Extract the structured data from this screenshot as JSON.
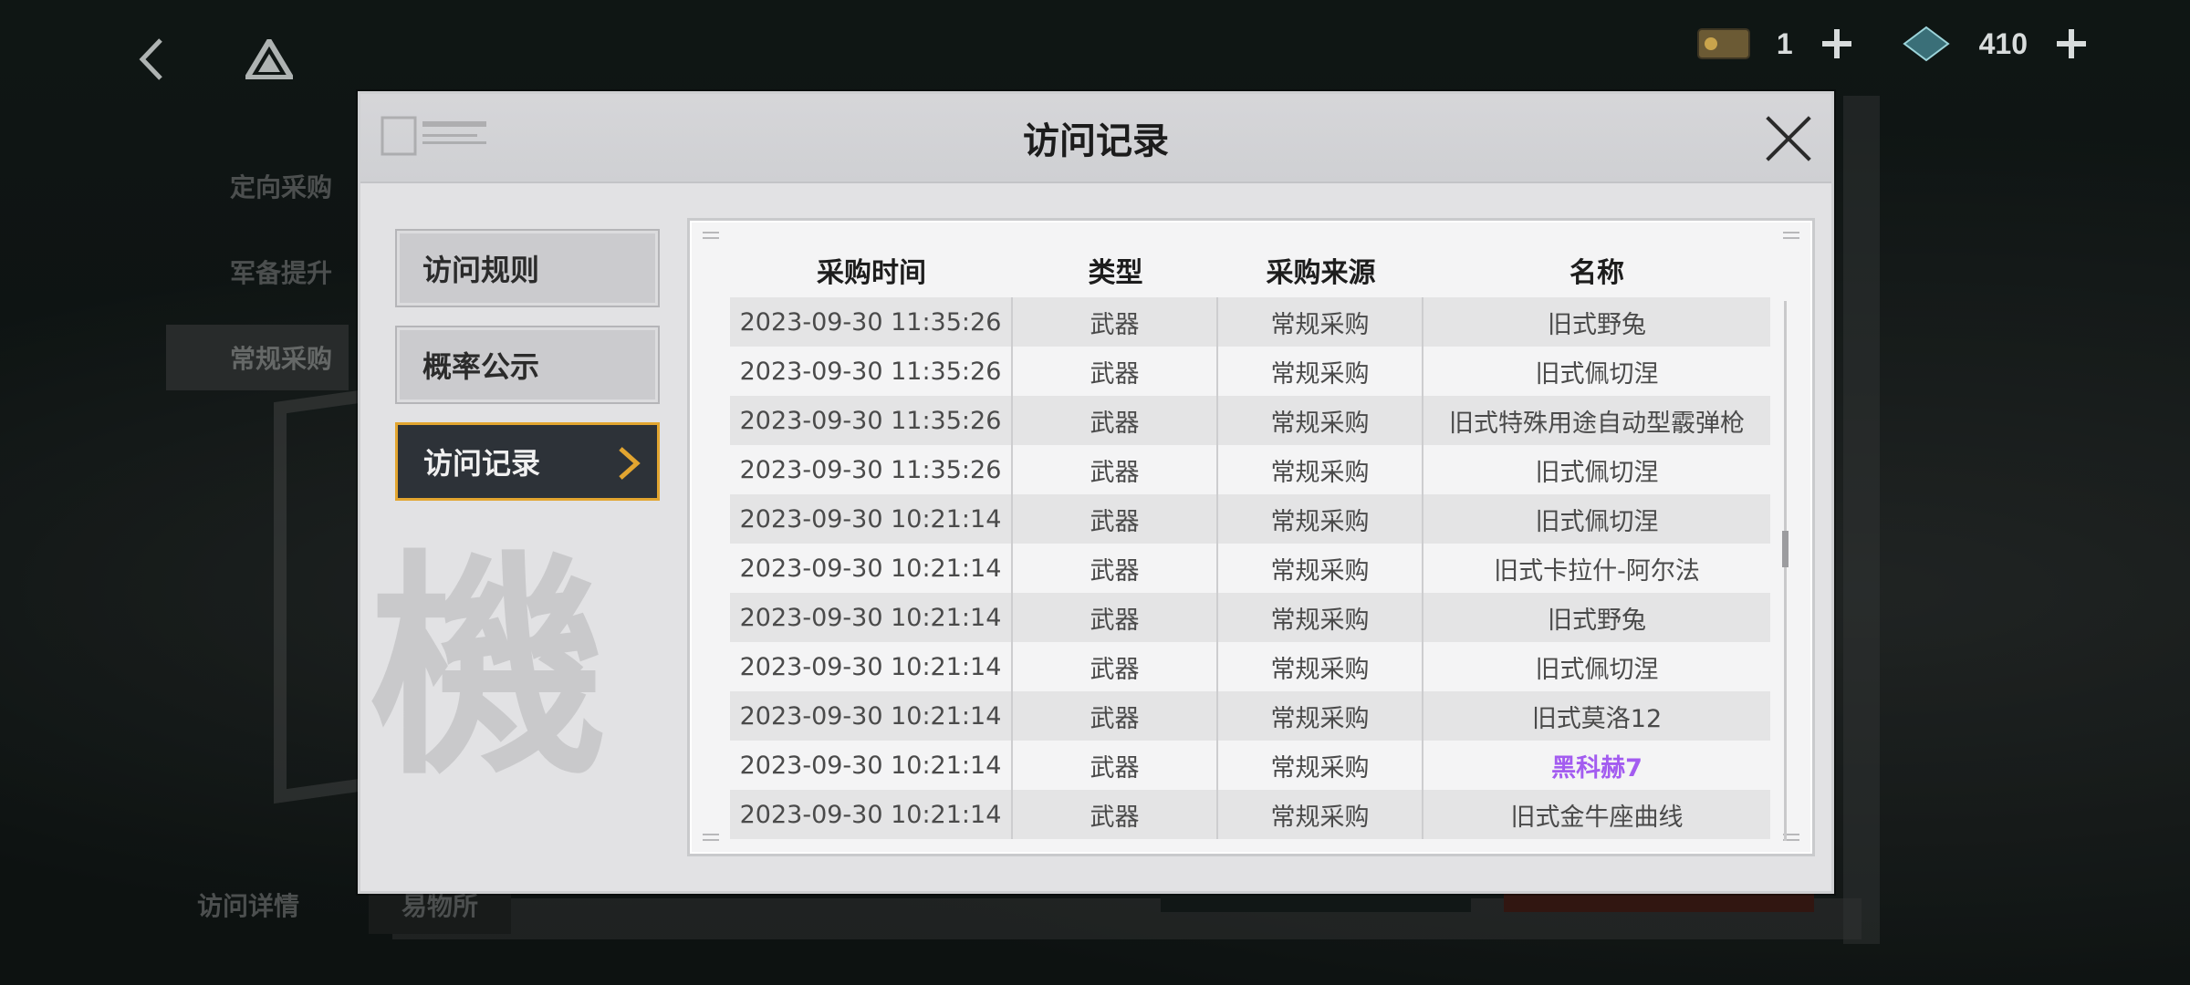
{
  "top_bar": {
    "resource_1_count": "1",
    "resource_2_count": "410"
  },
  "background_nav": {
    "items": [
      {
        "label": "定向采购"
      },
      {
        "label": "军备提升"
      },
      {
        "label": "常规采购"
      }
    ],
    "bottom_tabs": [
      {
        "label": "访问详情"
      },
      {
        "label": "易物所"
      }
    ]
  },
  "modal": {
    "title": "访问记录",
    "side_tabs": [
      {
        "label": "访问规则"
      },
      {
        "label": "概率公示"
      },
      {
        "label": "访问记录"
      }
    ],
    "watermark": "機",
    "table": {
      "headers": [
        "采购时间",
        "类型",
        "采购来源",
        "名称"
      ],
      "rows": [
        {
          "time": "2023-09-30 11:35:26",
          "type": "武器",
          "source": "常规采购",
          "name": "旧式野兔"
        },
        {
          "time": "2023-09-30 11:35:26",
          "type": "武器",
          "source": "常规采购",
          "name": "旧式佩切涅"
        },
        {
          "time": "2023-09-30 11:35:26",
          "type": "武器",
          "source": "常规采购",
          "name": "旧式特殊用途自动型霰弹枪"
        },
        {
          "time": "2023-09-30 11:35:26",
          "type": "武器",
          "source": "常规采购",
          "name": "旧式佩切涅"
        },
        {
          "time": "2023-09-30 10:21:14",
          "type": "武器",
          "source": "常规采购",
          "name": "旧式佩切涅"
        },
        {
          "time": "2023-09-30 10:21:14",
          "type": "武器",
          "source": "常规采购",
          "name": "旧式卡拉什-阿尔法"
        },
        {
          "time": "2023-09-30 10:21:14",
          "type": "武器",
          "source": "常规采购",
          "name": "旧式野兔"
        },
        {
          "time": "2023-09-30 10:21:14",
          "type": "武器",
          "source": "常规采购",
          "name": "旧式佩切涅"
        },
        {
          "time": "2023-09-30 10:21:14",
          "type": "武器",
          "source": "常规采购",
          "name": "旧式莫洛12"
        },
        {
          "time": "2023-09-30 10:21:14",
          "type": "武器",
          "source": "常规采购",
          "name": "黑科赫7"
        },
        {
          "time": "2023-09-30 10:21:14",
          "type": "武器",
          "source": "常规采购",
          "name": "旧式金牛座曲线"
        }
      ]
    }
  },
  "colors": {
    "active_tab_border": "#e2a530",
    "active_tab_bg": "#2d3238",
    "rare_item": "#a35cf0"
  },
  "icons": {
    "back": "chevron-left-icon",
    "logo": "triangle-logo-icon",
    "close": "close-icon",
    "active_arrow": "chevron-right-icon"
  }
}
